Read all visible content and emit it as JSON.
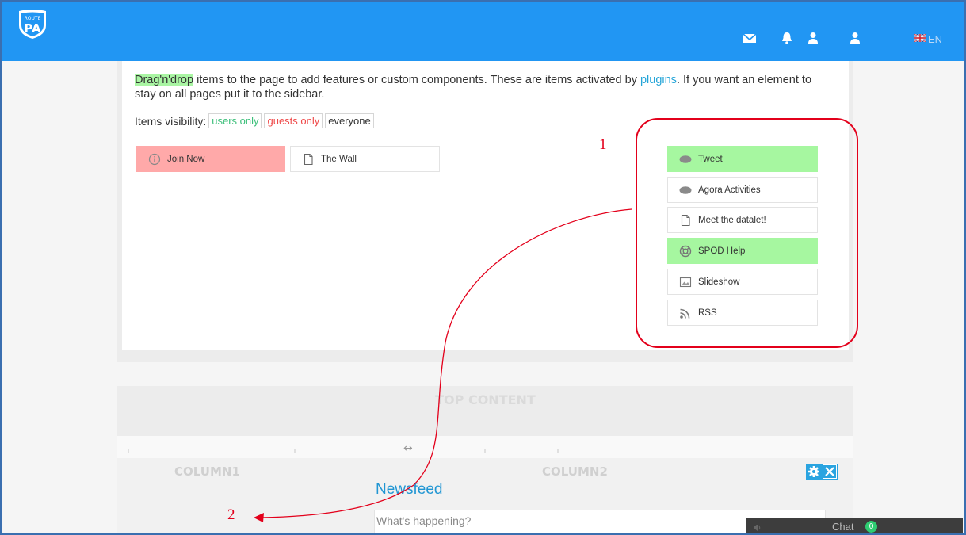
{
  "header": {
    "logo_text_top": "ROUTE",
    "logo_text_bottom": "PA",
    "language": "EN"
  },
  "intro": {
    "drag_label": "Drag'n'drop",
    "text_before_link": " items to the page to add features or custom components. These are items activated by ",
    "plugins_link": "plugins",
    "text_after_link": ". If you want an element to stay on all pages put it to the sidebar."
  },
  "visibility": {
    "label": "Items visibility:",
    "users_only": "users only",
    "guests_only": "guests only",
    "everyone": "everyone"
  },
  "placed_items": [
    {
      "label": "Join Now",
      "icon": "info-icon",
      "color": "#ffa9a9"
    },
    {
      "label": "The Wall",
      "icon": "document-icon"
    }
  ],
  "available_items": [
    {
      "label": "Tweet",
      "icon": "speech-bubble-icon",
      "color": "#a6f7a0"
    },
    {
      "label": "Agora Activities",
      "icon": "speech-bubble-icon"
    },
    {
      "label": "Meet the datalet!",
      "icon": "document-icon"
    },
    {
      "label": "SPOD Help",
      "icon": "help-lifebuoy-icon",
      "color": "#a6f7a0"
    },
    {
      "label": "Slideshow",
      "icon": "image-icon"
    },
    {
      "label": "RSS",
      "icon": "rss-icon"
    }
  ],
  "annotations": {
    "one": "1",
    "two": "2"
  },
  "layout_sections": {
    "top_content": "TOP CONTENT",
    "column1": "COLUMN1",
    "column2": "COLUMN2",
    "resize_arrow": "↔"
  },
  "newsfeed": {
    "title": "Newsfeed",
    "placeholder": "What's happening?"
  },
  "chat": {
    "label": "Chat",
    "count": "0"
  },
  "colors": {
    "topbar": "#2196f3",
    "annotation_red": "#e3001b",
    "highlight_green": "#a6f7a0",
    "highlight_red": "#ffa9a9",
    "link": "#25a5d8"
  }
}
